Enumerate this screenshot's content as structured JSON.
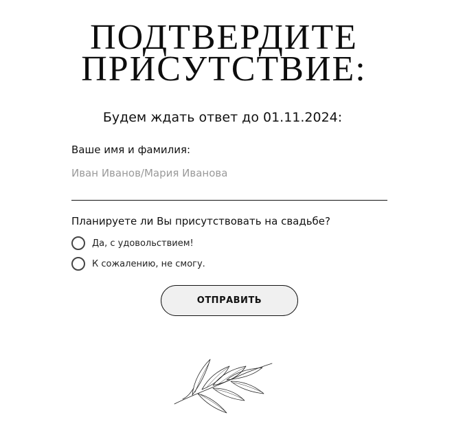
{
  "rsvp": {
    "title_line1": "ПОДТВЕРДИТЕ",
    "title_line2": "ПРИСУТСТВИЕ:",
    "deadline": "Будем ждать ответ до 01.11.2024:",
    "name_label": "Ваше имя и фамилия:",
    "name_placeholder": "Иван Иванов/Мария Иванова",
    "name_value": "",
    "attendance_question": "Планируете ли Вы присутствовать на свадьбе?",
    "options": [
      {
        "label": "Да, с удовольствием!",
        "selected": false
      },
      {
        "label": "К сожалению, не смогу.",
        "selected": false
      }
    ],
    "submit_label": "ОТПРАВИТЬ"
  },
  "decoration": {
    "icon": "leaf-branch-icon"
  },
  "colors": {
    "text": "#111111",
    "placeholder": "#9a9a9a",
    "button_bg": "#f0f0f0",
    "background": "#ffffff"
  }
}
